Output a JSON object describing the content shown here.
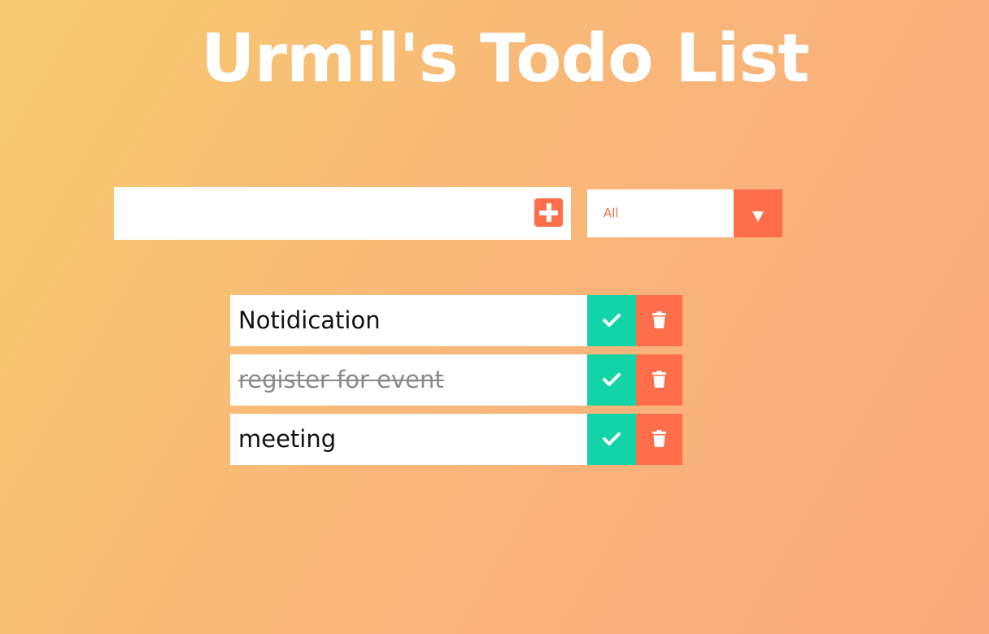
{
  "header": {
    "title": "Urmil's Todo List"
  },
  "form": {
    "input_value": "",
    "input_placeholder": "",
    "add_icon": "plus-square-icon"
  },
  "filter": {
    "selected": "All",
    "icon": "caret-down-icon"
  },
  "todos": [
    {
      "text": "Notidication",
      "completed": false
    },
    {
      "text": "register for event",
      "completed": true
    },
    {
      "text": "meeting",
      "completed": false
    }
  ],
  "item_actions": {
    "complete_icon": "check-icon",
    "delete_icon": "trash-icon"
  },
  "colors": {
    "accent": "#fe6e4a",
    "complete": "#12d4a6",
    "background_start": "#f6ca6e",
    "background_end": "#faa87d"
  }
}
